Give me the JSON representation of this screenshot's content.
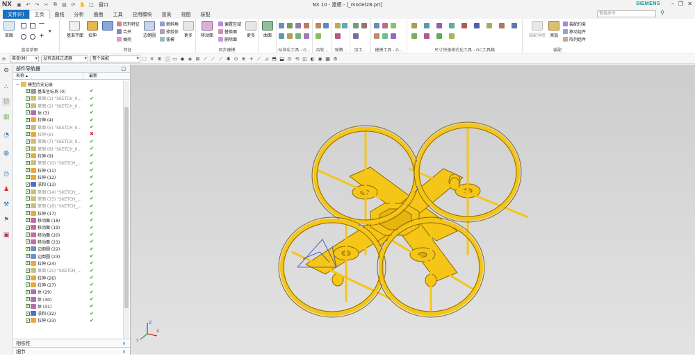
{
  "app": {
    "logo": "NX",
    "title": "NX 10 - 建模 - [_model28.prt]",
    "window_menu": "窗口",
    "brand": "SIEMENS"
  },
  "tabs": [
    "文件(F)",
    "主页",
    "曲线",
    "分析",
    "曲面",
    "工具",
    "应用模块",
    "渲染",
    "视图",
    "装配"
  ],
  "active_tab": "主页",
  "search": {
    "placeholder": "查找命令"
  },
  "ribbon": {
    "groups": [
      "直接草图",
      "特征",
      "同步建模",
      "标准化工具 - G...",
      "齿轮...",
      "弹簧...",
      "加工...",
      "建模工具 - G...",
      "尺寸快速格式化工具 - GC工具箱",
      "装配"
    ],
    "sketch": "草图",
    "datum_plane": "基准平面",
    "extrude": "拉伸",
    "pattern_feature": "阵列特征",
    "unite": "合并",
    "shell": "抽壳",
    "edge_blend": "边倒圆",
    "chamfer": "倒斜角",
    "trim_body": "修剪体",
    "draft": "拔模",
    "more1": "更多",
    "move_face": "移动面",
    "offset_region": "偏置区域",
    "replace_face": "替换面",
    "delete_face": "删除面",
    "more2": "更多",
    "surface": "曲面",
    "more3": "更多",
    "assembly_nav": "装配导航",
    "add": "添加",
    "constraints": "装配约束",
    "move_component": "移动组件",
    "pattern_component": "阵列组件"
  },
  "toolbar2": {
    "menu": "菜单(M)",
    "filter": "没有选择过滤器",
    "scope": "整个装配"
  },
  "navigator": {
    "title": "部件导航器",
    "col_name": "名称",
    "col_latest": "最新",
    "root": "模型历史记录",
    "items": [
      {
        "name": "基准坐标系 (0)",
        "status": "ok",
        "dim": false
      },
      {
        "name": "草图 (1) \"SKETCH_0...",
        "status": "ok",
        "dim": true
      },
      {
        "name": "草图 (2) \"SKETCH_0...",
        "status": "ok",
        "dim": true
      },
      {
        "name": "体 (3)",
        "status": "ok",
        "dim": false
      },
      {
        "name": "拉伸 (4)",
        "status": "ok",
        "dim": false
      },
      {
        "name": "草图 (5) \"SKETCH_0...",
        "status": "ok",
        "dim": true
      },
      {
        "name": "拉伸 (6)",
        "status": "bad",
        "dim": true
      },
      {
        "name": "草图 (7) \"SKETCH_0...",
        "status": "ok",
        "dim": true
      },
      {
        "name": "草图 (8) \"SKETCH_0...",
        "status": "ok",
        "dim": true
      },
      {
        "name": "拉伸 (9)",
        "status": "ok",
        "dim": false
      },
      {
        "name": "草图 (10) \"SKETCH_...",
        "status": "ok",
        "dim": true
      },
      {
        "name": "拉伸 (11)",
        "status": "ok",
        "dim": false
      },
      {
        "name": "拉伸 (12)",
        "status": "ok",
        "dim": false
      },
      {
        "name": "求和 (13)",
        "status": "ok",
        "dim": false
      },
      {
        "name": "草图 (14) \"SKETCH_...",
        "status": "ok",
        "dim": true
      },
      {
        "name": "草图 (15) \"SKETCH_...",
        "status": "ok",
        "dim": true
      },
      {
        "name": "草图 (16) \"SKETCH_...",
        "status": "ok",
        "dim": true
      },
      {
        "name": "拉伸 (17)",
        "status": "ok",
        "dim": false
      },
      {
        "name": "移动面 (18)",
        "status": "ok",
        "dim": false
      },
      {
        "name": "移动面 (19)",
        "status": "ok",
        "dim": false
      },
      {
        "name": "移动面 (20)",
        "status": "ok",
        "dim": false
      },
      {
        "name": "移动面 (21)",
        "status": "ok",
        "dim": false
      },
      {
        "name": "边倒圆 (22)",
        "status": "ok",
        "dim": false
      },
      {
        "name": "边倒圆 (23)",
        "status": "ok",
        "dim": false
      },
      {
        "name": "拉伸 (24)",
        "status": "ok",
        "dim": false
      },
      {
        "name": "草图 (25) \"SKETCH_...",
        "status": "ok",
        "dim": true
      },
      {
        "name": "拉伸 (26)",
        "status": "ok",
        "dim": false
      },
      {
        "name": "拉伸 (27)",
        "status": "ok",
        "dim": false
      },
      {
        "name": "体 (29)",
        "status": "ok",
        "dim": false
      },
      {
        "name": "体 (30)",
        "status": "ok",
        "dim": false
      },
      {
        "name": "体 (31)",
        "status": "ok",
        "dim": false
      },
      {
        "name": "求和 (32)",
        "status": "ok",
        "dim": false
      },
      {
        "name": "拉伸 (33)",
        "status": "ok",
        "dim": false
      }
    ],
    "panel_dependents": "相依性",
    "panel_details": "细节"
  },
  "colors": {
    "accent": "#1a70c0",
    "model": "#f5c518",
    "model_edge": "#8a6a00",
    "ok": "#1e9e1e",
    "bad": "#d01010"
  },
  "triad": {
    "x": "X",
    "y": "Y",
    "z": "Z"
  }
}
